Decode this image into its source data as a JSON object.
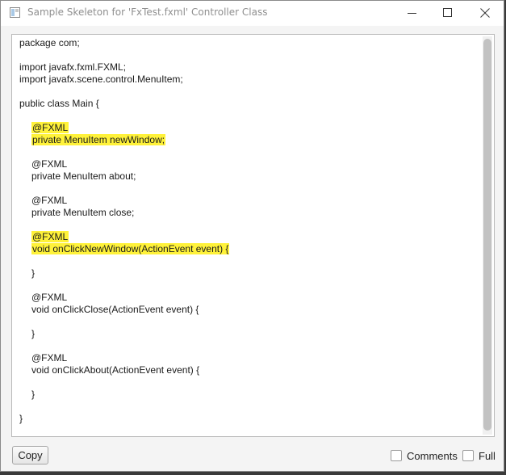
{
  "window": {
    "title": "Sample Skeleton for 'FxTest.fxml' Controller Class"
  },
  "code": {
    "lines": [
      {
        "text": "package com;",
        "indent": false,
        "highlight": false
      },
      {
        "text": "",
        "indent": false,
        "highlight": false
      },
      {
        "text": "import javafx.fxml.FXML;",
        "indent": false,
        "highlight": false
      },
      {
        "text": "import javafx.scene.control.MenuItem;",
        "indent": false,
        "highlight": false
      },
      {
        "text": "",
        "indent": false,
        "highlight": false
      },
      {
        "text": "public class Main {",
        "indent": false,
        "highlight": false
      },
      {
        "text": "",
        "indent": false,
        "highlight": false
      },
      {
        "text": "@FXML",
        "indent": true,
        "highlight": true
      },
      {
        "text": "private MenuItem newWindow;",
        "indent": true,
        "highlight": true
      },
      {
        "text": "",
        "indent": false,
        "highlight": false
      },
      {
        "text": "@FXML",
        "indent": true,
        "highlight": false
      },
      {
        "text": "private MenuItem about;",
        "indent": true,
        "highlight": false
      },
      {
        "text": "",
        "indent": false,
        "highlight": false
      },
      {
        "text": "@FXML",
        "indent": true,
        "highlight": false
      },
      {
        "text": "private MenuItem close;",
        "indent": true,
        "highlight": false
      },
      {
        "text": "",
        "indent": false,
        "highlight": false
      },
      {
        "text": "@FXML",
        "indent": true,
        "highlight": true
      },
      {
        "text": "void onClickNewWindow(ActionEvent event) {",
        "indent": true,
        "highlight": true
      },
      {
        "text": "",
        "indent": false,
        "highlight": false
      },
      {
        "text": "}",
        "indent": true,
        "highlight": false
      },
      {
        "text": "",
        "indent": false,
        "highlight": false
      },
      {
        "text": "@FXML",
        "indent": true,
        "highlight": false
      },
      {
        "text": "void onClickClose(ActionEvent event) {",
        "indent": true,
        "highlight": false
      },
      {
        "text": "",
        "indent": false,
        "highlight": false
      },
      {
        "text": "}",
        "indent": true,
        "highlight": false
      },
      {
        "text": "",
        "indent": false,
        "highlight": false
      },
      {
        "text": "@FXML",
        "indent": true,
        "highlight": false
      },
      {
        "text": "void onClickAbout(ActionEvent event) {",
        "indent": true,
        "highlight": false
      },
      {
        "text": "",
        "indent": false,
        "highlight": false
      },
      {
        "text": "}",
        "indent": true,
        "highlight": false
      },
      {
        "text": "",
        "indent": false,
        "highlight": false
      },
      {
        "text": "}",
        "indent": false,
        "highlight": false
      }
    ]
  },
  "footer": {
    "copy_label": "Copy",
    "comments_label": "Comments",
    "comments_checked": false,
    "full_label": "Full",
    "full_checked": false
  },
  "colors": {
    "highlight": "#fff23a"
  },
  "icons": {
    "app": "window-app-icon",
    "minimize": "minimize-icon",
    "maximize": "maximize-icon",
    "close": "close-icon"
  }
}
